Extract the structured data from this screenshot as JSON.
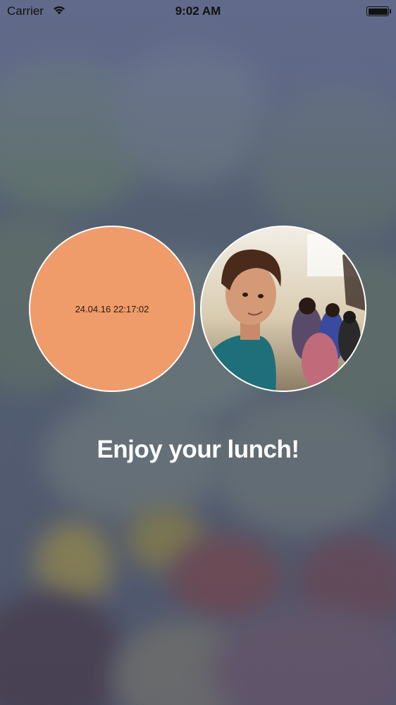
{
  "status_bar": {
    "carrier": "Carrier",
    "time": "9:02 AM",
    "wifi_icon": "wifi-icon",
    "battery_icon": "battery-icon"
  },
  "date_circle": {
    "timestamp": "24.04.16 22:17:02",
    "color": "#ef9b6a"
  },
  "photo_circle": {
    "icon": "user-photo"
  },
  "headline": "Enjoy your lunch!"
}
